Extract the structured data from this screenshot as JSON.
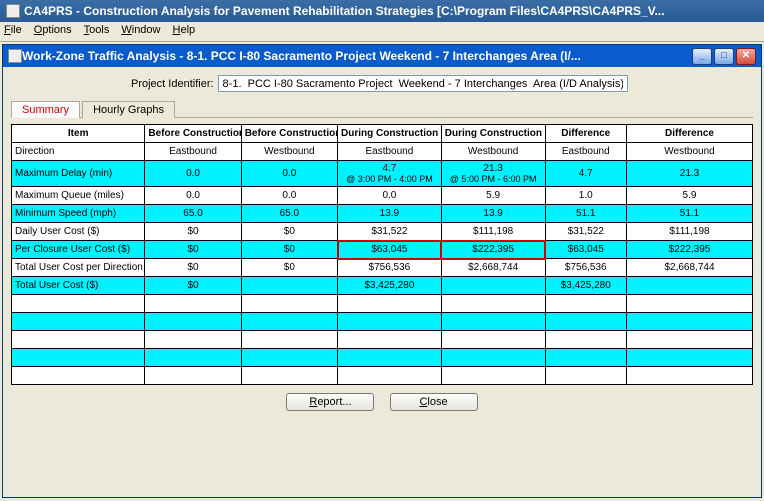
{
  "app": {
    "title": "CA4PRS - Construction Analysis for Pavement Rehabilitation Strategies [C:\\Program Files\\CA4PRS\\CA4PRS_V..."
  },
  "menu": {
    "file": "File",
    "options": "Options",
    "tools": "Tools",
    "window": "Window",
    "help": "Help"
  },
  "inner": {
    "title": "Work-Zone Traffic Analysis - 8-1.  PCC I-80 Sacramento Project  Weekend - 7 Interchanges  Area (I/...",
    "project_identifier_label": "Project Identifier:",
    "project_identifier_value": "8-1.  PCC I-80 Sacramento Project  Weekend - 7 Interchanges  Area (I/D Analysis)"
  },
  "tabs": {
    "summary": "Summary",
    "hourly": "Hourly Graphs"
  },
  "grid": {
    "headers": [
      "Item",
      "Before Construction",
      "Before Construction",
      "During Construction",
      "During Construction",
      "Difference",
      "Difference"
    ],
    "rows": [
      {
        "cyan": false,
        "item": "Direction",
        "cells": [
          "Eastbound",
          "Westbound",
          "Eastbound",
          "Westbound",
          "Eastbound",
          "Westbound"
        ]
      },
      {
        "cyan": true,
        "item": "Maximum Delay (min)",
        "cells": [
          "0.0",
          "0.0",
          "4.7",
          "21.3",
          "4.7",
          "21.3"
        ],
        "sub": [
          "",
          "",
          "@ 3:00 PM - 4:00 PM",
          "@ 5:00 PM - 6:00 PM",
          "",
          ""
        ]
      },
      {
        "cyan": false,
        "item": "Maximum Queue (miles)",
        "cells": [
          "0.0",
          "0.0",
          "0.0",
          "5.9",
          "1.0",
          "5.9"
        ]
      },
      {
        "cyan": true,
        "item": "Minimum Speed (mph)",
        "cells": [
          "65.0",
          "65.0",
          "13.9",
          "13.9",
          "51.1",
          "51.1"
        ]
      },
      {
        "cyan": false,
        "item": "Daily User Cost ($)",
        "cells": [
          "$0",
          "$0",
          "$31,522",
          "$111,198",
          "$31,522",
          "$111,198"
        ]
      },
      {
        "cyan": true,
        "item": "Per Closure User Cost ($)",
        "cells": [
          "$0",
          "$0",
          "$63,045",
          "$222,395",
          "$63,045",
          "$222,395"
        ],
        "highlight": [
          2,
          3
        ]
      },
      {
        "cyan": false,
        "item": "Total User Cost per Direction ($)",
        "cells": [
          "$0",
          "$0",
          "$756,536",
          "$2,668,744",
          "$756,536",
          "$2,668,744"
        ]
      },
      {
        "cyan": true,
        "item": "Total User Cost ($)",
        "cells": [
          "$0",
          "",
          "$3,425,280",
          "",
          "$3,425,280",
          ""
        ]
      },
      {
        "cyan": false,
        "item": "",
        "cells": [
          "",
          "",
          "",
          "",
          "",
          ""
        ]
      },
      {
        "cyan": true,
        "item": "",
        "cells": [
          "",
          "",
          "",
          "",
          "",
          ""
        ]
      },
      {
        "cyan": false,
        "item": "",
        "cells": [
          "",
          "",
          "",
          "",
          "",
          ""
        ]
      },
      {
        "cyan": true,
        "item": "",
        "cells": [
          "",
          "",
          "",
          "",
          "",
          ""
        ]
      },
      {
        "cyan": false,
        "item": "",
        "cells": [
          "",
          "",
          "",
          "",
          "",
          ""
        ]
      }
    ]
  },
  "buttons": {
    "report": "Report...",
    "close": "Close"
  }
}
